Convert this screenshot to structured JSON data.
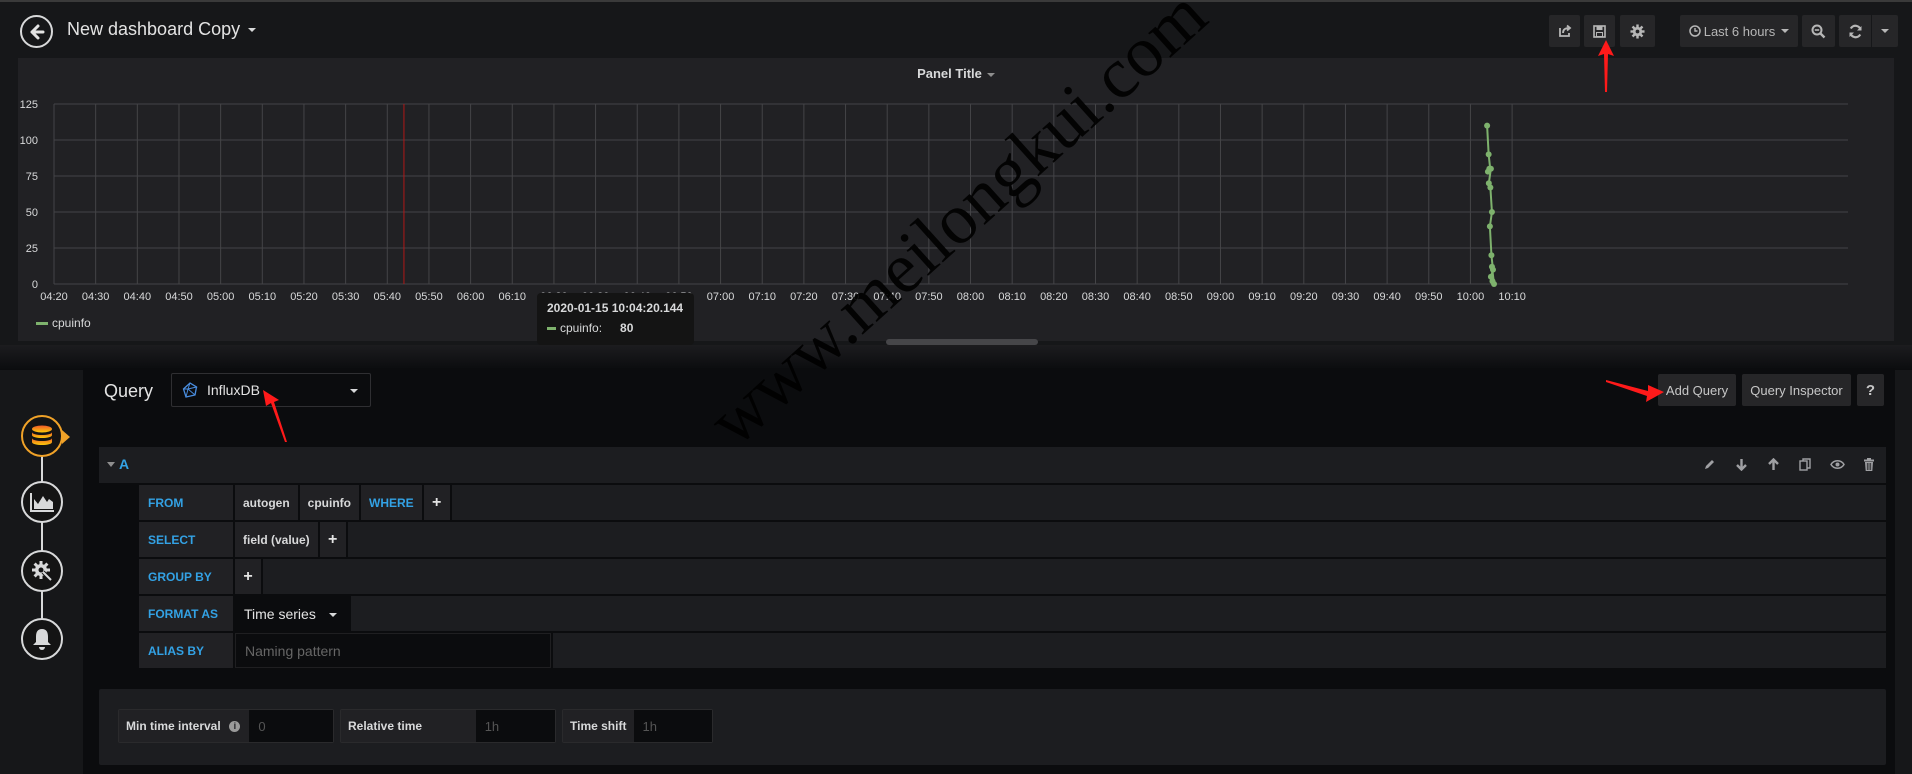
{
  "header": {
    "title": "New dashboard Copy",
    "time_range": "Last 6 hours",
    "icons": [
      "back-arrow-icon",
      "share-icon",
      "save-icon",
      "gear-icon",
      "clock-icon",
      "zoom-out-icon",
      "refresh-icon",
      "chevron-down-icon"
    ]
  },
  "panel": {
    "title": "Panel Title",
    "legend": [
      {
        "name": "cpuinfo",
        "color": "#7eb26d"
      }
    ],
    "tooltip": {
      "time": "2020-01-15 10:04:20.144",
      "series": "cpuinfo:",
      "value": "80"
    }
  },
  "chart_data": {
    "type": "line",
    "title": "Panel Title",
    "xlabel": "",
    "ylabel": "",
    "ylim": [
      0,
      125
    ],
    "yticks": [
      "0",
      "25",
      "50",
      "75",
      "100",
      "125"
    ],
    "xticks": [
      "04:20",
      "04:30",
      "04:40",
      "04:50",
      "05:00",
      "05:10",
      "05:20",
      "05:30",
      "05:40",
      "05:50",
      "06:00",
      "06:10",
      "06:20",
      "06:30",
      "06:40",
      "06:50",
      "07:00",
      "07:10",
      "07:20",
      "07:30",
      "07:40",
      "07:50",
      "08:00",
      "08:10",
      "08:20",
      "08:30",
      "08:40",
      "08:50",
      "09:00",
      "09:10",
      "09:20",
      "09:30",
      "09:40",
      "09:50",
      "10:00",
      "10:10"
    ],
    "xlim_minutes": [
      0,
      360
    ],
    "grid": true,
    "legend_position": "bottom-left",
    "crosshair_x": "05:44",
    "series": [
      {
        "name": "cpuinfo",
        "color": "#7eb26d",
        "x": [
          "10:04:00",
          "10:04:05",
          "10:04:10",
          "10:04:12",
          "10:04:15",
          "10:04:20",
          "10:04:25",
          "10:04:30",
          "10:04:35",
          "10:04:40",
          "10:04:45",
          "10:04:50",
          "10:04:55",
          "10:05:00",
          "10:05:05",
          "10:05:10"
        ],
        "values": [
          110,
          90,
          80,
          78,
          80,
          80,
          70,
          67,
          50,
          40,
          20,
          10,
          5,
          2,
          0,
          12
        ]
      }
    ]
  },
  "query": {
    "label": "Query",
    "datasource": "InfluxDB",
    "add_query": "Add Query",
    "query_inspector": "Query Inspector",
    "help": "?",
    "ref_id": "A",
    "rows": {
      "from": {
        "label": "FROM",
        "policy": "autogen",
        "measurement": "cpuinfo",
        "where": "WHERE"
      },
      "select": {
        "label": "SELECT",
        "field": "field (value)"
      },
      "group_by": {
        "label": "GROUP BY"
      },
      "format_as": {
        "label": "FORMAT AS",
        "value": "Time series"
      },
      "alias_by": {
        "label": "ALIAS BY",
        "placeholder": "Naming pattern"
      }
    },
    "options": {
      "min_interval": {
        "label": "Min time interval",
        "placeholder": "0"
      },
      "relative_time": {
        "label": "Relative time",
        "placeholder": "1h"
      },
      "time_shift": {
        "label": "Time shift",
        "placeholder": "1h"
      }
    }
  },
  "sidebar": [
    "queries",
    "visualization",
    "general",
    "alert"
  ],
  "watermark": "www.meilongkui.com",
  "colors": {
    "accent": "#33a2e5",
    "series": "#7eb26d",
    "active": "#f0a228",
    "annotation": "#ff1a1a"
  }
}
